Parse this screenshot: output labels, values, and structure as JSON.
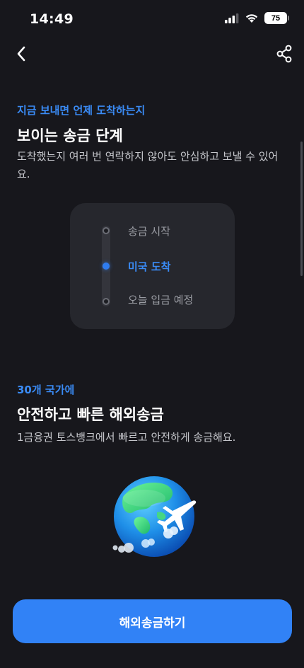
{
  "status_bar": {
    "time": "14:49",
    "battery": "75",
    "icons": [
      "signal-icon",
      "wifi-icon",
      "battery-icon"
    ]
  },
  "nav": {
    "back_icon": "chevron-left-icon",
    "share_icon": "share-icon"
  },
  "section_steps": {
    "eyebrow": "지금 보내면 언제 도착하는지",
    "title": "보이는 송금 단계",
    "description": "도착했는지 여러 번 연락하지 않아도 안심하고 보낼 수 있어요.",
    "steps": [
      {
        "label": "송금 시작",
        "active": false
      },
      {
        "label": "미국 도착",
        "active": true
      },
      {
        "label": "오늘 입금 예정",
        "active": false
      }
    ]
  },
  "section_countries": {
    "eyebrow": "30개 국가에",
    "title": "안전하고 빠른 해외송금",
    "description": "1금융권 토스뱅크에서 빠르고 안전하게 송금해요.",
    "illustration": "globe-airplane-illustration"
  },
  "cta": {
    "label": "해외송금하기"
  },
  "colors": {
    "background": "#17171c",
    "accent": "#3182f6",
    "eyebrow": "#3a8bf5",
    "card": "#26272d"
  }
}
